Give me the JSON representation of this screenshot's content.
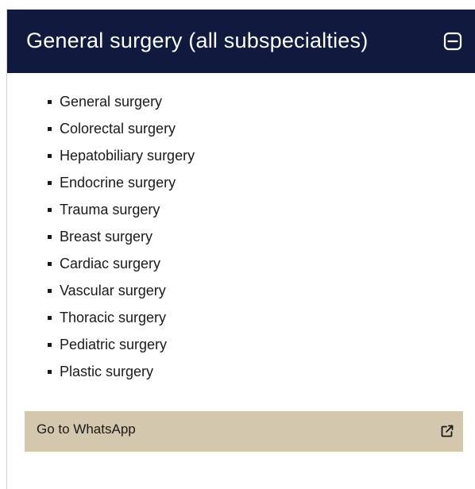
{
  "panel": {
    "title": "General surgery (all subspecialties)",
    "collapse_icon": "minus-square-icon",
    "items": [
      {
        "label": "General surgery"
      },
      {
        "label": "Colorectal surgery"
      },
      {
        "label": "Hepatobiliary surgery"
      },
      {
        "label": "Endocrine surgery"
      },
      {
        "label": "Trauma surgery"
      },
      {
        "label": "Breast surgery"
      },
      {
        "label": "Cardiac surgery"
      },
      {
        "label": "Vascular surgery"
      },
      {
        "label": "Thoracic surgery"
      },
      {
        "label": "Pediatric surgery"
      },
      {
        "label": "Plastic surgery"
      }
    ],
    "link": {
      "label": "Go to WhatsApp",
      "icon": "external-link-icon"
    }
  },
  "colors": {
    "header_bg": "#0f1a3e",
    "header_text": "#ffffff",
    "link_bg": "#d3c7ad",
    "text": "#1a1a1a"
  }
}
